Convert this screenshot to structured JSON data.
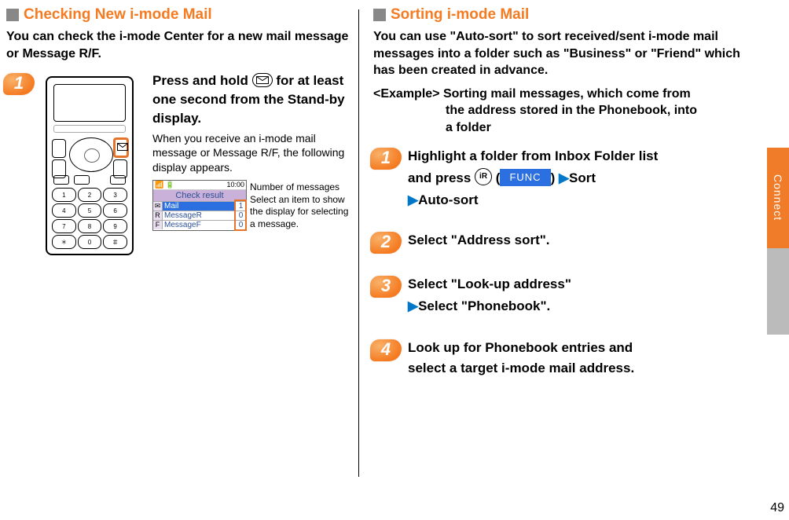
{
  "left": {
    "section_title": "Checking New i-mode Mail",
    "intro": "You can check the i-mode Center for a new mail message or Message R/F.",
    "step1": {
      "head_l1": "Press and hold ",
      "head_l2": " for at least one second from the Stand-by display.",
      "sub": "When you receive an i-mode mail message or Message R/F, the following display appears.",
      "check_result": {
        "time": "10:00",
        "title": "Check result",
        "rows": [
          {
            "label": "Mail",
            "count": "1"
          },
          {
            "label": "MessageR",
            "count": "0"
          },
          {
            "label": "MessageF",
            "count": "0"
          }
        ]
      },
      "caption_a": "Number of messages",
      "caption_b": "Select an item to show the display for selecting a message."
    }
  },
  "right": {
    "section_title": "Sorting i-mode Mail",
    "intro": "You can use \"Auto-sort\" to sort received/sent i-mode mail messages into a folder such as \"Business\" or \"Friend\" which has been created in advance.",
    "example_head": "<Example> Sorting mail messages, which come from",
    "example_l2": "the address stored in the Phonebook, into",
    "example_l3": "a folder",
    "step1": {
      "line1": "Highlight a folder from Inbox Folder list",
      "line2_a": "and press ",
      "line2_b": "(",
      "func": "FUNC",
      "line2_c": ")",
      "line2_d": "Sort",
      "line3": "Auto-sort"
    },
    "step2": "Select \"Address sort\".",
    "step3": {
      "line1": "Select \"Look-up address\"",
      "line2": "Select \"Phonebook\"."
    },
    "step4": {
      "line1": "Look up for Phonebook entries and",
      "line2": "select a target i-mode mail address."
    }
  },
  "side": {
    "tab": "Connect",
    "page": "49"
  },
  "icons": {
    "envelope": "envelope-icon",
    "ir": "iR"
  },
  "phone": {
    "keys": [
      "1",
      "2",
      "3",
      "4",
      "5",
      "6",
      "7",
      "8",
      "9",
      "＊",
      "0",
      "＃"
    ]
  }
}
